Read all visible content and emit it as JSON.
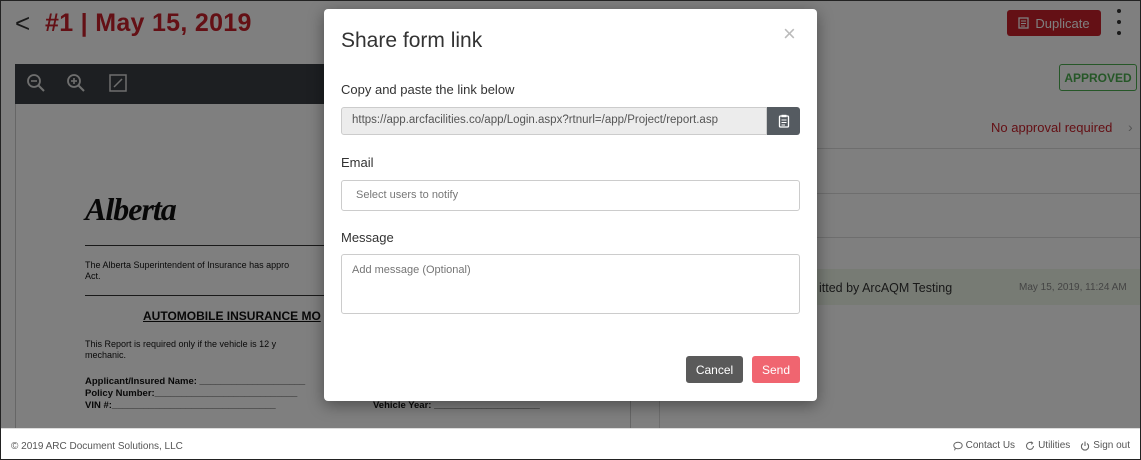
{
  "header": {
    "back_glyph": "<",
    "title": "#1 | May 15, 2019",
    "duplicate_label": "Duplicate"
  },
  "right_panel": {
    "status_badge": "APPROVED",
    "approval_text": "No approval required",
    "activity_text": "itted by ArcAQM Testing",
    "activity_date": "May 15, 2019, 11:24 AM"
  },
  "document": {
    "logo_text": "Alberta",
    "intro_line1": "The Alberta Superintendent of Insurance has appro",
    "intro_line2": "Act.",
    "heading": "AUTOMOBILE INSURANCE MO",
    "report_line1": "This Report is required only if the vehicle is 12 y",
    "report_line2": "mechanic.",
    "field_applicant": "Applicant/Insured Name: ____________________",
    "field_policy": "Policy Number:___________________________",
    "field_vin": "VIN #:_______________________________",
    "field_vehicle_year": "Vehicle Year: ____________________"
  },
  "modal": {
    "title": "Share form link",
    "close_glyph": "×",
    "copy_label": "Copy and paste the link below",
    "link_value": "https://app.arcfacilities.co/app/Login.aspx?rtnurl=/app/Project/report.asp",
    "email_label": "Email",
    "email_placeholder": "Select users to notify",
    "message_label": "Message",
    "message_placeholder": "Add message (Optional)",
    "cancel_label": "Cancel",
    "send_label": "Send"
  },
  "footer": {
    "copyright": "© 2019 ARC Document Solutions, LLC",
    "contact_label": "Contact Us",
    "utilities_label": "Utilities",
    "signout_label": "Sign out"
  },
  "colors": {
    "brand_red": "#c8202a",
    "approved_green": "#4caf50",
    "send_pink": "#f06570"
  }
}
